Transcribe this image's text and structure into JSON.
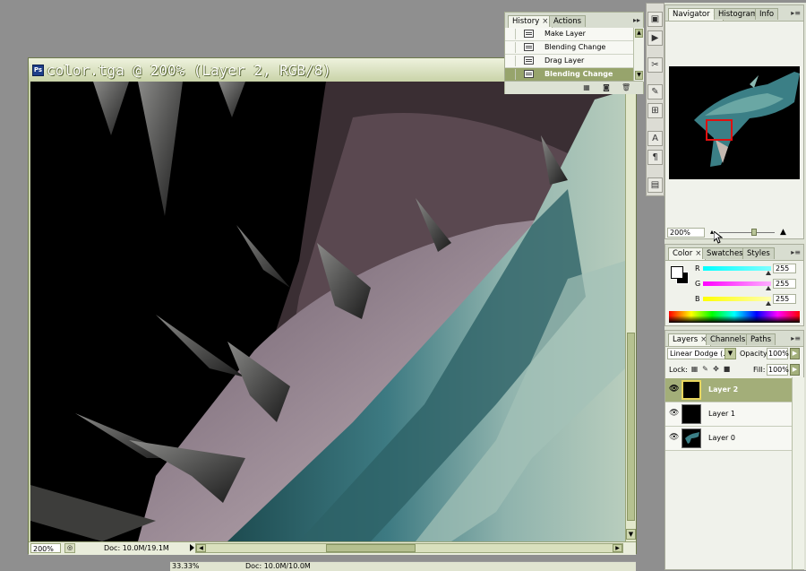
{
  "document": {
    "title": "color.tga @ 200% (Layer 2, RGB/8)",
    "zoom": "200%",
    "doc_size": "Doc: 10.0M/19.1M"
  },
  "document2": {
    "zoom": "33.33%",
    "doc_size": "Doc: 10.0M/10.0M"
  },
  "history": {
    "tabs": [
      {
        "label": "History",
        "close": "×"
      },
      {
        "label": "Actions"
      }
    ],
    "items": [
      {
        "label": "Make Layer"
      },
      {
        "label": "Blending Change"
      },
      {
        "label": "Drag Layer"
      },
      {
        "label": "Blending Change"
      }
    ],
    "selected_index": 3
  },
  "navigator": {
    "tabs": [
      {
        "label": "Navigator",
        "close": "×"
      },
      {
        "label": "Histogram"
      },
      {
        "label": "Info"
      }
    ],
    "zoom": "200%"
  },
  "color": {
    "tabs": [
      {
        "label": "Color",
        "close": "×"
      },
      {
        "label": "Swatches"
      },
      {
        "label": "Styles"
      }
    ],
    "channels": [
      {
        "label": "R",
        "value": "255"
      },
      {
        "label": "G",
        "value": "255"
      },
      {
        "label": "B",
        "value": "255"
      }
    ]
  },
  "layers": {
    "tabs": [
      {
        "label": "Layers",
        "close": "×"
      },
      {
        "label": "Channels"
      },
      {
        "label": "Paths"
      }
    ],
    "blend_mode": "Linear Dodge (...",
    "opacity_label": "Opacity:",
    "opacity": "100%",
    "lock_label": "Lock:",
    "fill_label": "Fill:",
    "fill": "100%",
    "items": [
      {
        "label": "Layer 2"
      },
      {
        "label": "Layer 1"
      },
      {
        "label": "Layer 0"
      }
    ],
    "selected_index": 0
  },
  "icons": {
    "menu": "panel-menu-icon",
    "eye": "visibility-eye-icon",
    "tool_well": [
      "history-brush-icon",
      "play-action-icon",
      "crop-tool-icon",
      "brush-tool-icon",
      "clone-stamp-icon",
      "character-icon",
      "paragraph-icon",
      "layer-comps-icon"
    ]
  },
  "colors": {
    "doc_frame": "#c6cfa8",
    "selection": "#97a46c",
    "nav_view_box": "#e01010"
  }
}
